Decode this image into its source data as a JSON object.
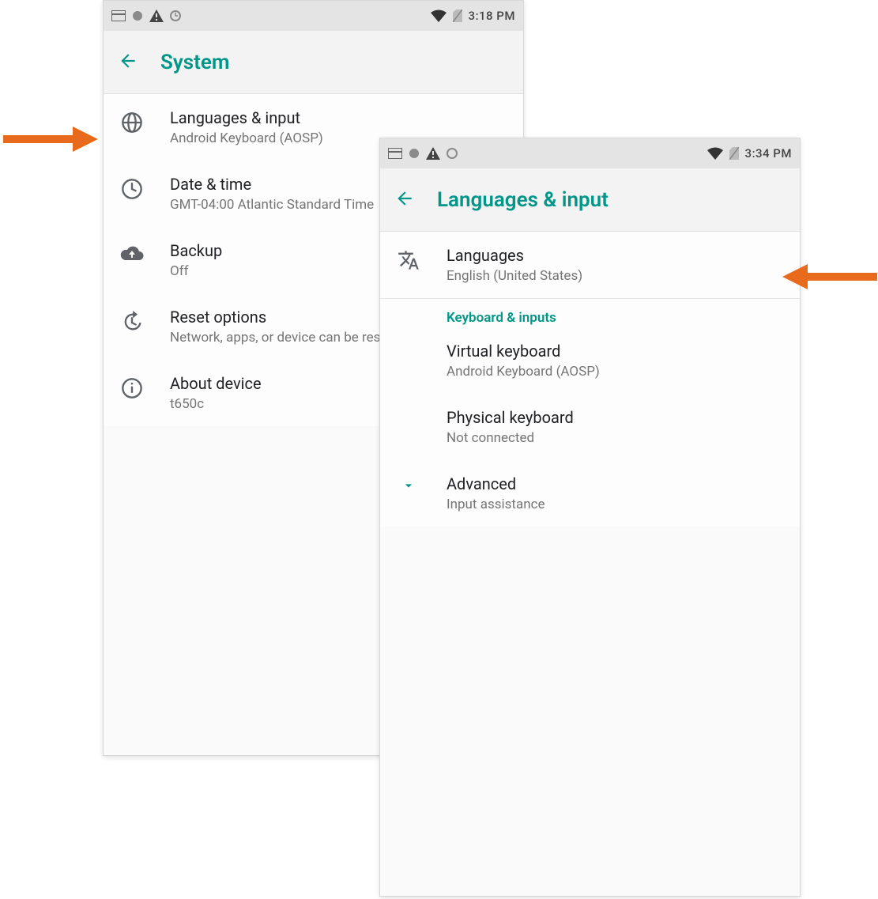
{
  "annotations": {
    "arrow_color": "#e86a1c"
  },
  "phone1": {
    "status": {
      "time": "3:18 PM"
    },
    "title": "System",
    "items": [
      {
        "icon": "globe",
        "title": "Languages & input",
        "subtitle": "Android Keyboard (AOSP)"
      },
      {
        "icon": "clock",
        "title": "Date & time",
        "subtitle": "GMT-04:00 Atlantic Standard Time"
      },
      {
        "icon": "cloud-up",
        "title": "Backup",
        "subtitle": "Off"
      },
      {
        "icon": "restore",
        "title": "Reset options",
        "subtitle": "Network, apps, or device can be reset"
      },
      {
        "icon": "info",
        "title": "About device",
        "subtitle": "t650c"
      }
    ]
  },
  "phone2": {
    "status": {
      "time": "3:34 PM"
    },
    "title": "Languages & input",
    "languages": {
      "title": "Languages",
      "subtitle": "English (United States)"
    },
    "section_header": "Keyboard & inputs",
    "virtual_kb": {
      "title": "Virtual keyboard",
      "subtitle": "Android Keyboard (AOSP)"
    },
    "physical_kb": {
      "title": "Physical keyboard",
      "subtitle": "Not connected"
    },
    "advanced": {
      "title": "Advanced",
      "subtitle": "Input assistance"
    }
  }
}
